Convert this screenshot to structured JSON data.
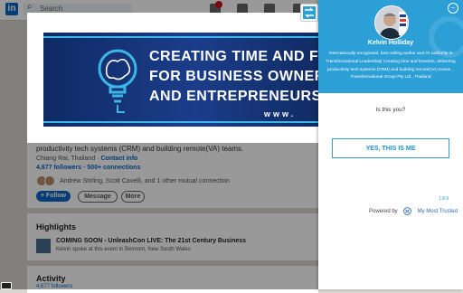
{
  "background": {
    "search_placeholder": "Search",
    "headline_tail": "productivity tech systems (CRM) and building remote(VA) teams.",
    "location": "Chiang Rai, Thailand",
    "contact_info": "Contact info",
    "stats": "4,677 followers · 500+ connections",
    "mutual_connections": "Andrew Stirling, Scott Cavelli, and 1 other mutual connection",
    "follow_label": "+ Follow",
    "message_label": "Message",
    "more_label": "More",
    "highlights_title": "Highlights",
    "highlight_event": "COMING SOON - UnleashCon LIVE: The 21st Century Business",
    "highlight_sub": "Kelvin spoke at this event in Belmont, New South Wales",
    "activity_title": "Activity",
    "activity_sub": "4,677 followers"
  },
  "banner": {
    "line1": "CREATING TIME AND FR",
    "line2": "FOR BUSINESS OWNERS",
    "line3": "AND ENTREPRENEURS",
    "url": "www.",
    "colors": {
      "bg": "#1b3d8a",
      "accent": "#3bb6e6"
    }
  },
  "panel": {
    "name": "Kelvin Holliday",
    "bio_lines": [
      "Internationally recognised, best selling author and #1 authority in",
      "Transformational Leadership| Creating time and freedom, delivering",
      "productivity tech systems (CRM) and building remote(VA) teams. ,",
      "Transformational Group Pty Ltd., Thailand"
    ],
    "question": "Is this you?",
    "confirm_label": "YES, THIS IS ME",
    "version": "1.8.9",
    "powered_by": "Powered by",
    "brand": "My Most Trusted",
    "accent_color": "#2b9fd6"
  }
}
